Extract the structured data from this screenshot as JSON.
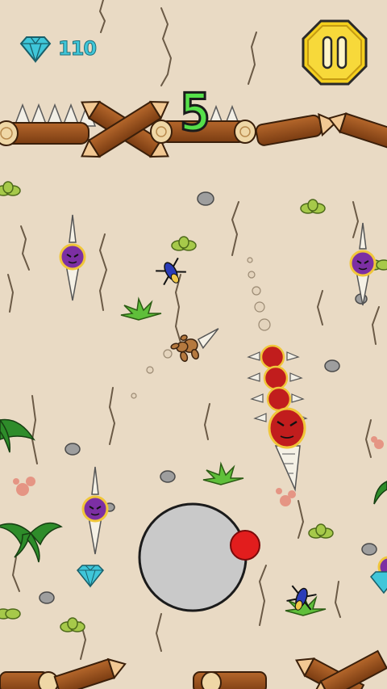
{
  "hud": {
    "gem_count": "110",
    "score": "5"
  },
  "icons": {
    "gem": "diamond-icon",
    "pause": "pause-icon",
    "joystick": "virtual-joystick"
  },
  "colors": {
    "background": "#e9dac4",
    "gem": "#3fc6d9",
    "score": "#56e04a",
    "pause_fill": "#f4cf1d",
    "joystick_base": "#c9c9c9",
    "joystick_knob": "#e21d1d",
    "worm_body": "#c11d1d",
    "enemy_head": "#7c2fa3"
  }
}
